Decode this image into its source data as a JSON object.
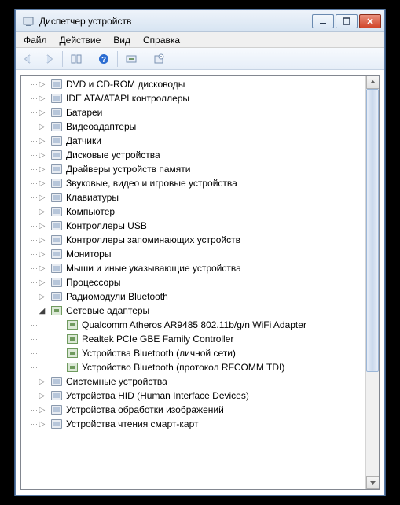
{
  "window": {
    "title": "Диспетчер устройств"
  },
  "menu": {
    "file": "Файл",
    "action": "Действие",
    "view": "Вид",
    "help": "Справка"
  },
  "tree": {
    "items": [
      {
        "label": "DVD и CD-ROM дисководы",
        "depth": 1,
        "state": "collapsed",
        "icon": "disc"
      },
      {
        "label": "IDE ATA/ATAPI контроллеры",
        "depth": 1,
        "state": "collapsed",
        "icon": "ide"
      },
      {
        "label": "Батареи",
        "depth": 1,
        "state": "collapsed",
        "icon": "battery"
      },
      {
        "label": "Видеоадаптеры",
        "depth": 1,
        "state": "collapsed",
        "icon": "display"
      },
      {
        "label": "Датчики",
        "depth": 1,
        "state": "collapsed",
        "icon": "sensor"
      },
      {
        "label": "Дисковые устройства",
        "depth": 1,
        "state": "collapsed",
        "icon": "disk"
      },
      {
        "label": "Драйверы устройств памяти",
        "depth": 1,
        "state": "collapsed",
        "icon": "memory"
      },
      {
        "label": "Звуковые, видео и игровые устройства",
        "depth": 1,
        "state": "collapsed",
        "icon": "sound"
      },
      {
        "label": "Клавиатуры",
        "depth": 1,
        "state": "collapsed",
        "icon": "keyboard"
      },
      {
        "label": "Компьютер",
        "depth": 1,
        "state": "collapsed",
        "icon": "computer"
      },
      {
        "label": "Контроллеры USB",
        "depth": 1,
        "state": "collapsed",
        "icon": "usb"
      },
      {
        "label": "Контроллеры запоминающих устройств",
        "depth": 1,
        "state": "collapsed",
        "icon": "storage"
      },
      {
        "label": "Мониторы",
        "depth": 1,
        "state": "collapsed",
        "icon": "monitor"
      },
      {
        "label": "Мыши и иные указывающие устройства",
        "depth": 1,
        "state": "collapsed",
        "icon": "mouse"
      },
      {
        "label": "Процессоры",
        "depth": 1,
        "state": "collapsed",
        "icon": "cpu"
      },
      {
        "label": "Радиомодули Bluetooth",
        "depth": 1,
        "state": "collapsed",
        "icon": "bluetooth"
      },
      {
        "label": "Сетевые адаптеры",
        "depth": 1,
        "state": "expanded",
        "icon": "network"
      },
      {
        "label": "Qualcomm Atheros AR9485 802.11b/g/n WiFi Adapter",
        "depth": 2,
        "state": "leaf",
        "icon": "nic"
      },
      {
        "label": "Realtek PCIe GBE Family Controller",
        "depth": 2,
        "state": "leaf",
        "icon": "nic"
      },
      {
        "label": "Устройства Bluetooth (личной сети)",
        "depth": 2,
        "state": "leaf",
        "icon": "nic"
      },
      {
        "label": "Устройство Bluetooth (протокол RFCOMM TDI)",
        "depth": 2,
        "state": "leaf",
        "icon": "nic"
      },
      {
        "label": "Системные устройства",
        "depth": 1,
        "state": "collapsed",
        "icon": "system"
      },
      {
        "label": "Устройства HID (Human Interface Devices)",
        "depth": 1,
        "state": "collapsed",
        "icon": "hid"
      },
      {
        "label": "Устройства обработки изображений",
        "depth": 1,
        "state": "collapsed",
        "icon": "imaging"
      },
      {
        "label": "Устройства чтения смарт-карт",
        "depth": 1,
        "state": "collapsed",
        "icon": "smartcard"
      }
    ]
  }
}
